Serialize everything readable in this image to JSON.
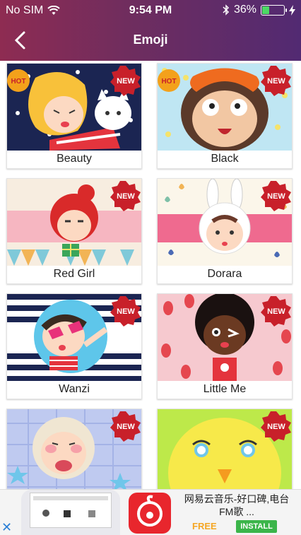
{
  "status_bar": {
    "carrier": "No SIM",
    "time": "9:54 PM",
    "battery_text": "36%",
    "battery_level": 0.36
  },
  "header": {
    "title": "Emoji"
  },
  "cards": [
    {
      "label": "Beauty",
      "badges": [
        "HOT",
        "NEW"
      ]
    },
    {
      "label": "Black",
      "badges": [
        "HOT",
        "NEW"
      ]
    },
    {
      "label": "Red Girl",
      "badges": [
        "NEW"
      ]
    },
    {
      "label": "Dorara",
      "badges": [
        "NEW"
      ]
    },
    {
      "label": "Wanzi",
      "badges": [
        "NEW"
      ]
    },
    {
      "label": "Little Me",
      "badges": [
        "NEW"
      ]
    },
    {
      "label": "",
      "badges": [
        "NEW"
      ]
    },
    {
      "label": "",
      "badges": [
        "NEW"
      ]
    }
  ],
  "ad": {
    "title_line1": "网易云音乐-好口碑,电台",
    "title_line2": "FM歌 ...",
    "free_label": "FREE",
    "install_label": "INSTALL",
    "close_glyph": "✕"
  },
  "colors": {
    "header_start": "#8e2c52",
    "header_end": "#522a72",
    "new_badge": "#c8202a",
    "hot_badge": "#f3a11b",
    "install_button": "#3bb54a",
    "free_text": "#f5a623",
    "ad_icon": "#e8262d"
  }
}
